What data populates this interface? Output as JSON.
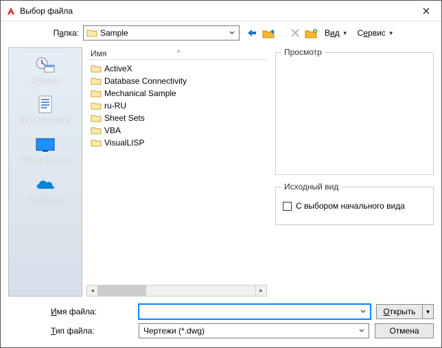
{
  "title": "Выбор файла",
  "folder_label_pre": "П",
  "folder_label_u": "а",
  "folder_label_post": "пка:",
  "folder_dropdown": {
    "value": "Sample"
  },
  "menu": {
    "view": "Вид",
    "view_u": "и",
    "view_pre": "В",
    "view_post": "д",
    "service": "Сервис",
    "service_pre": "С",
    "service_u": "е",
    "service_post": "рвис"
  },
  "list_header": {
    "name": "Имя"
  },
  "files": [
    {
      "name": "ActiveX"
    },
    {
      "name": "Database Connectivity"
    },
    {
      "name": "Mechanical Sample"
    },
    {
      "name": "ru-RU"
    },
    {
      "name": "Sheet Sets"
    },
    {
      "name": "VBA"
    },
    {
      "name": "VisualLISP"
    }
  ],
  "places": [
    {
      "id": "history",
      "label": "Журнал"
    },
    {
      "id": "documents",
      "label": "Документация"
    },
    {
      "id": "desktop",
      "label": "Рабочий стол"
    },
    {
      "id": "onedrive",
      "label": "OneDrive"
    }
  ],
  "preview_label": "Просмотр",
  "origin_label": "Исходный вид",
  "origin_checkbox_label": "С выбором начального вида",
  "filename_label_pre": "",
  "filename_label_u": "И",
  "filename_label_post": "мя файла:",
  "filetype_label_pre": "",
  "filetype_label_u": "Т",
  "filetype_label_post": "ип файла:",
  "filename_value": "",
  "filetype_value": "Чертежи (*.dwg)",
  "btn_open_pre": "",
  "btn_open_u": "О",
  "btn_open_post": "ткрыть",
  "btn_cancel": "Отмена"
}
